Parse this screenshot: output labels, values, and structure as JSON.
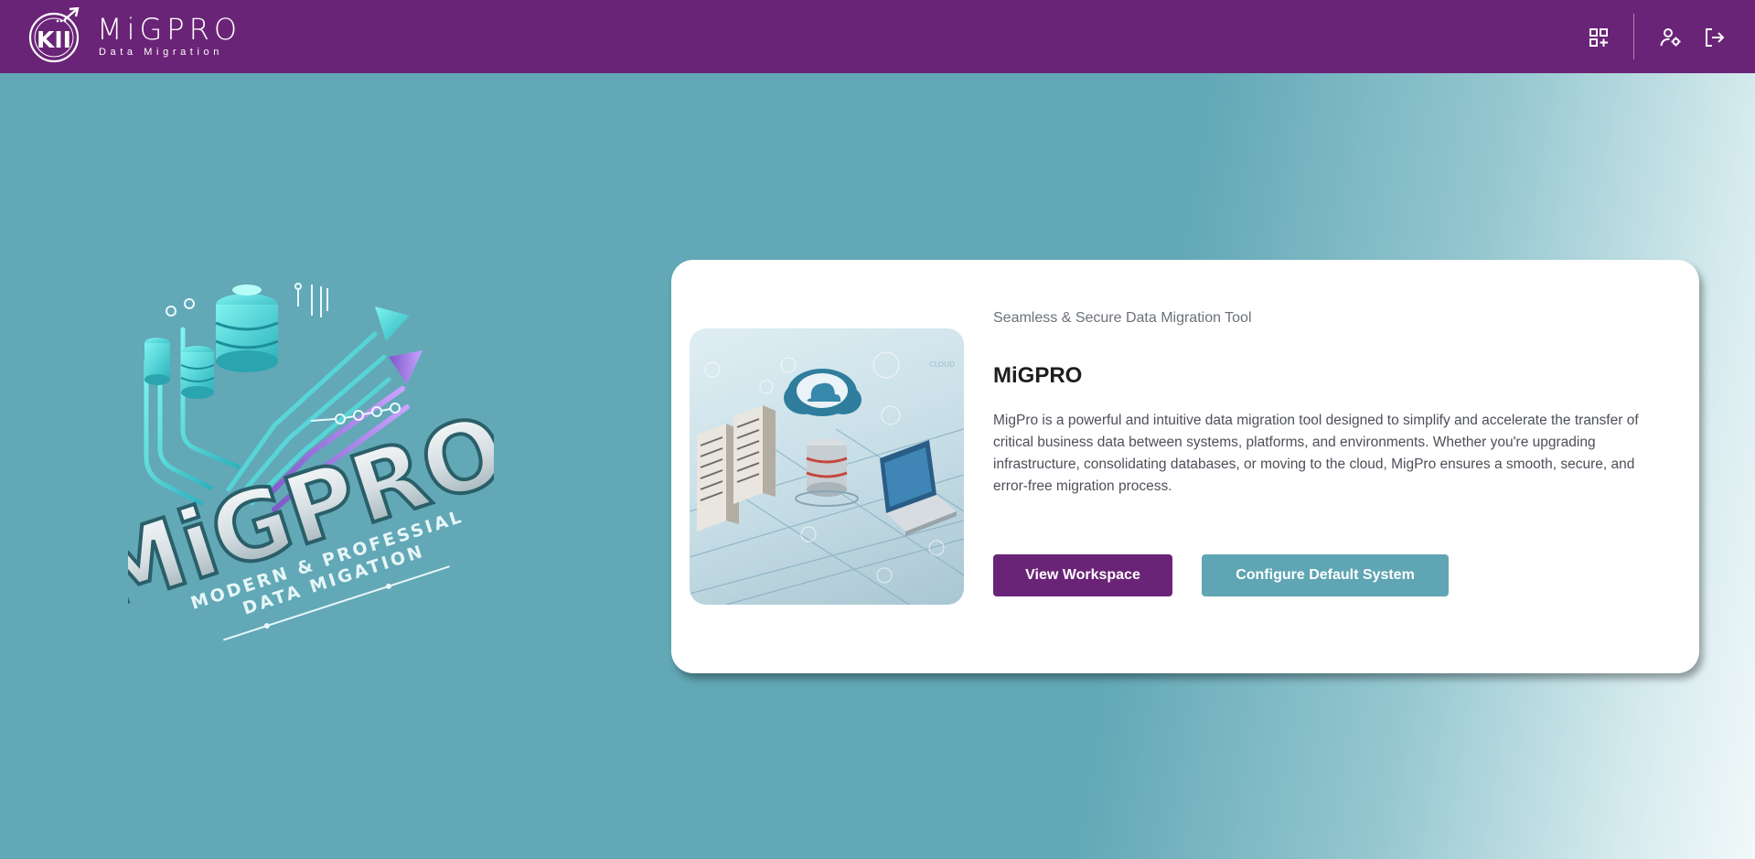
{
  "header": {
    "brand_name": "MiGPRO",
    "brand_subtitle": "Data Migration",
    "logo_mark_text": "KII",
    "icons": [
      "apps-add-icon",
      "user-settings-icon",
      "logout-icon"
    ],
    "background_color": "#6a2477"
  },
  "hero": {
    "logo_title": "MiGPRO",
    "logo_tagline_line1": "MODERN & PROFESSIAL",
    "logo_tagline_line2": "DATA MIGATION"
  },
  "card": {
    "tagline": "Seamless & Secure Data Migration Tool",
    "title": "MiGPRO",
    "description": "MigPro is a powerful and intuitive data migration tool designed to simplify and accelerate the transfer of critical business data between systems, platforms, and environments. Whether you're upgrading infrastructure, consolidating databases, or moving to the cloud, MigPro ensures a smooth, secure, and error-free migration process.",
    "illustration_label": "CLOUD",
    "primary_button": "View Workspace",
    "secondary_button": "Configure Default System"
  },
  "colors": {
    "brand_purple": "#6a2477",
    "accent_teal": "#5fa5b3",
    "page_background": "#62a8b6"
  }
}
